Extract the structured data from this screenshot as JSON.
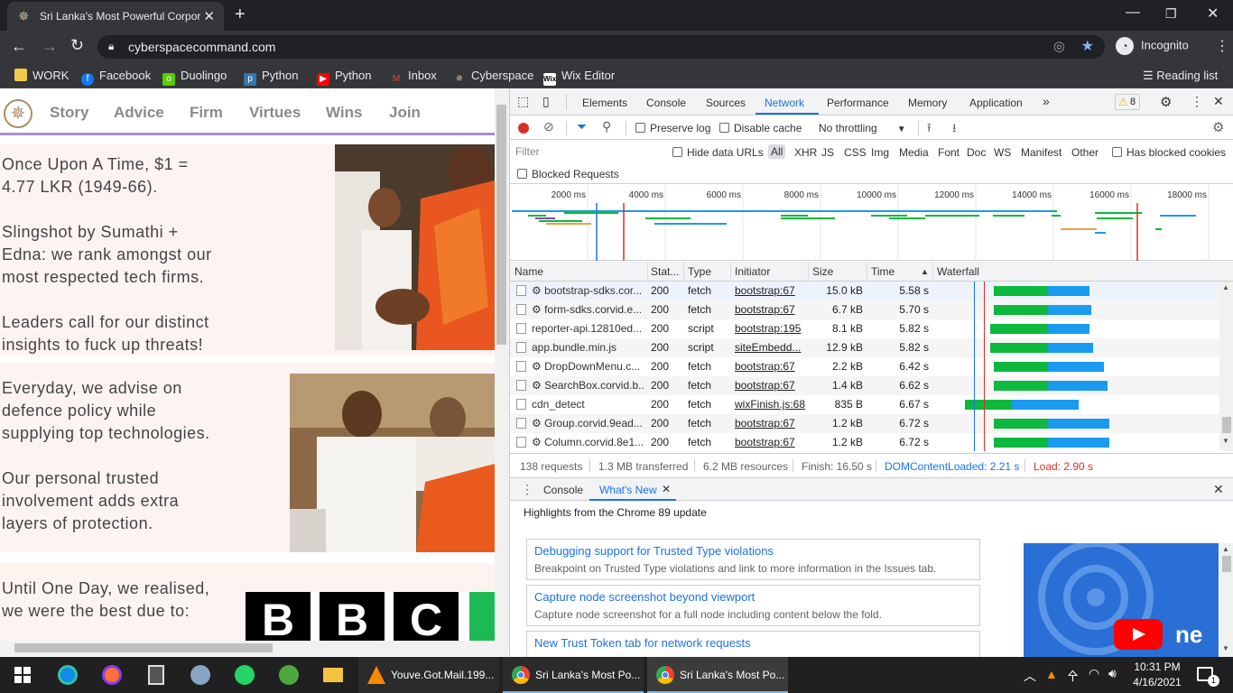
{
  "browser": {
    "tab_title": "Sri Lanka's Most Powerful Corporation",
    "new_tab": "+",
    "url": "cyberspacecommand.com",
    "profile_label": "Incognito",
    "reading_list": "Reading list",
    "bookmarks": [
      "WORK",
      "Facebook",
      "Duolingo",
      "Python",
      "Python",
      "Inbox",
      "Cyberspace",
      "Wix Editor"
    ]
  },
  "site": {
    "nav": [
      "Story",
      "Advice",
      "Firm",
      "Virtues",
      "Wins",
      "Join"
    ],
    "section1": {
      "p1a": "Once Upon A Time, $1 =",
      "p1b": "4.77 LKR (1949-66).",
      "p2a": "Slingshot by Sumathi +",
      "p2b": "Edna: we rank amongst our",
      "p2c": "most respected tech firms.",
      "p3a": "Leaders call for our distinct",
      "p3b": "insights to fuck up threats!"
    },
    "section2": {
      "p1a": "Everyday, we advise on",
      "p1b": "defence policy while",
      "p1c": "supplying top technologies.",
      "p2a": "Our personal trusted",
      "p2b": "involvement adds extra",
      "p2c": "layers of protection."
    },
    "section3": {
      "p1a": "Until One Day, we realised,",
      "p1b": "we were the best due to:",
      "logo_text": "BBC"
    }
  },
  "devtools": {
    "tabs": [
      "Elements",
      "Console",
      "Sources",
      "Network",
      "Performance",
      "Memory",
      "Application"
    ],
    "more": "»",
    "warnings": "8",
    "toolbar": {
      "preserve_log": "Preserve log",
      "disable_cache": "Disable cache",
      "throttling": "No throttling"
    },
    "filter": {
      "placeholder": "Filter",
      "hide_data_urls": "Hide data URLs",
      "types": [
        "All",
        "XHR",
        "JS",
        "CSS",
        "Img",
        "Media",
        "Font",
        "Doc",
        "WS",
        "Manifest",
        "Other"
      ],
      "has_blocked": "Has blocked cookies",
      "blocked_requests": "Blocked Requests"
    },
    "overview_ticks": [
      "2000 ms",
      "4000 ms",
      "6000 ms",
      "8000 ms",
      "10000 ms",
      "12000 ms",
      "14000 ms",
      "16000 ms",
      "18000 ms"
    ],
    "columns": [
      "Name",
      "Stat...",
      "Type",
      "Initiator",
      "Size",
      "Time",
      "Waterfall"
    ],
    "rows": [
      {
        "name": "bootstrap-sdks.cor...",
        "status": "200",
        "type": "fetch",
        "initiator": "bootstrap:67",
        "size": "15.0 kB",
        "time": "5.58 s",
        "gear": true
      },
      {
        "name": "form-sdks.corvid.e...",
        "status": "200",
        "type": "fetch",
        "initiator": "bootstrap:67",
        "size": "6.7 kB",
        "time": "5.70 s",
        "gear": true
      },
      {
        "name": "reporter-api.12810ed...",
        "status": "200",
        "type": "script",
        "initiator": "bootstrap:195",
        "size": "8.1 kB",
        "time": "5.82 s",
        "gear": false
      },
      {
        "name": "app.bundle.min.js",
        "status": "200",
        "type": "script",
        "initiator": "siteEmbedd...",
        "size": "12.9 kB",
        "time": "5.82 s",
        "gear": false
      },
      {
        "name": "DropDownMenu.c...",
        "status": "200",
        "type": "fetch",
        "initiator": "bootstrap:67",
        "size": "2.2 kB",
        "time": "6.42 s",
        "gear": true
      },
      {
        "name": "SearchBox.corvid.b...",
        "status": "200",
        "type": "fetch",
        "initiator": "bootstrap:67",
        "size": "1.4 kB",
        "time": "6.62 s",
        "gear": true
      },
      {
        "name": "cdn_detect",
        "status": "200",
        "type": "fetch",
        "initiator": "wixFinish.js:68",
        "size": "835 B",
        "time": "6.67 s",
        "gear": false
      },
      {
        "name": "Group.corvid.9ead...",
        "status": "200",
        "type": "fetch",
        "initiator": "bootstrap:67",
        "size": "1.2 kB",
        "time": "6.72 s",
        "gear": true
      },
      {
        "name": "Column.corvid.8e1...",
        "status": "200",
        "type": "fetch",
        "initiator": "bootstrap:67",
        "size": "1.2 kB",
        "time": "6.72 s",
        "gear": true
      }
    ],
    "status": {
      "requests": "138 requests",
      "transferred": "1.3 MB transferred",
      "resources": "6.2 MB resources",
      "finish": "Finish: 16.50 s",
      "dcl": "DOMContentLoaded: 2.21 s",
      "load": "Load: 2.90 s"
    },
    "drawer": {
      "tabs": [
        "Console",
        "What's New"
      ],
      "highlights": "Highlights from the Chrome 89 update",
      "cards": [
        {
          "title": "Debugging support for Trusted Type violations",
          "desc": "Breakpoint on Trusted Type violations and link to more information in the Issues tab."
        },
        {
          "title": "Capture node screenshot beyond viewport",
          "desc": "Capture node screenshot for a full node including content below the fold."
        },
        {
          "title": "New Trust Token tab for network requests",
          "desc": ""
        }
      ],
      "video_text": "ne"
    }
  },
  "taskbar": {
    "items": [
      "Youve.Got.Mail.199...",
      "Sri Lanka's Most Po...",
      "Sri Lanka's Most Po..."
    ],
    "time": "10:31 PM",
    "date": "4/16/2021",
    "notif_count": "1"
  }
}
